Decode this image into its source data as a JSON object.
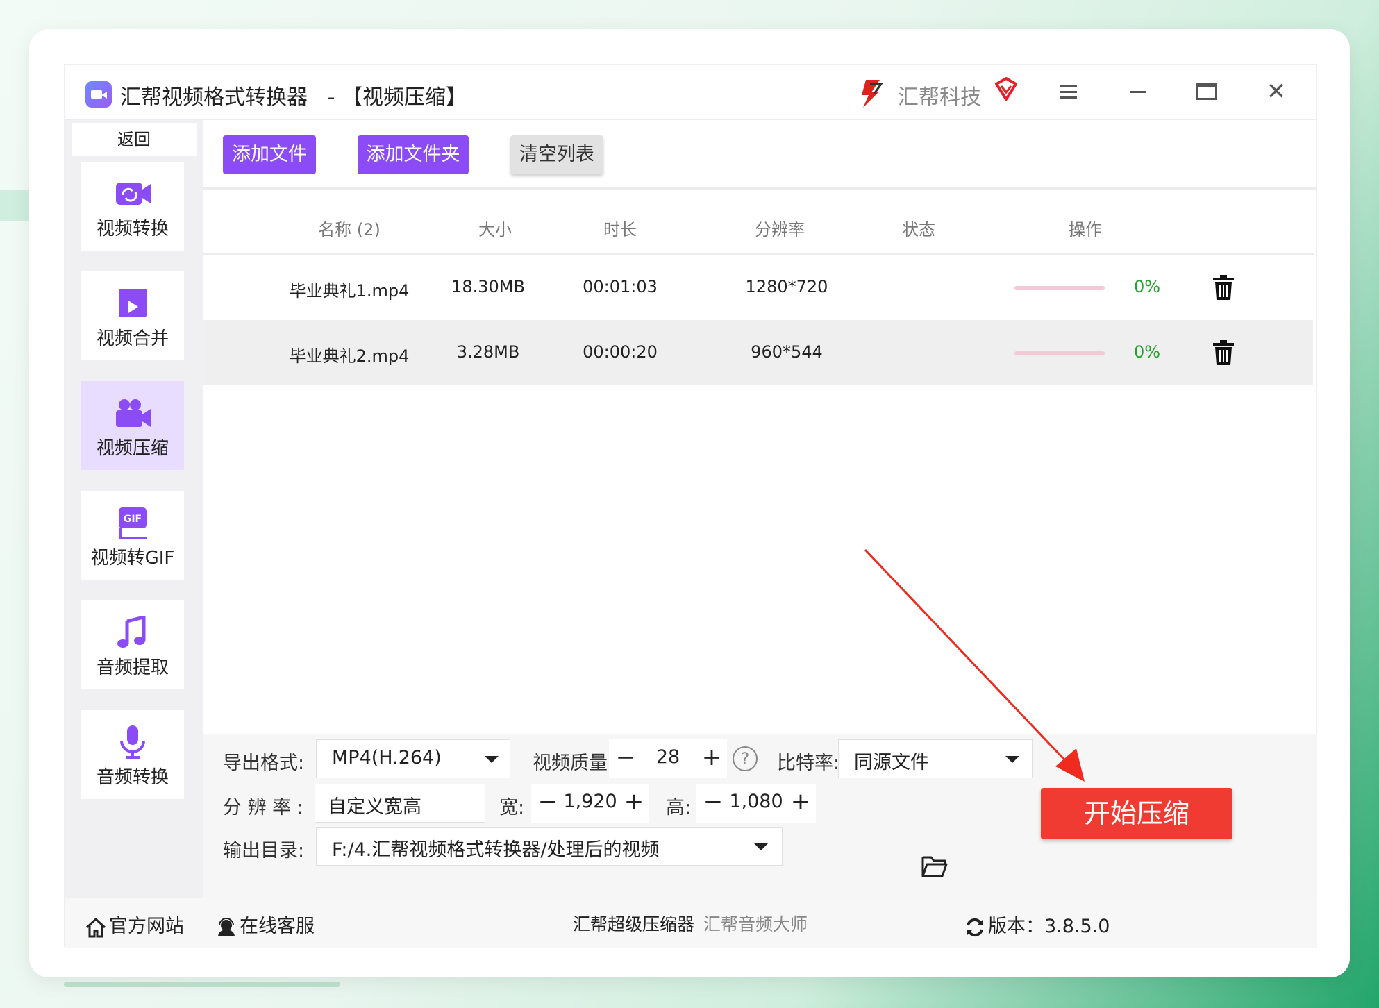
{
  "window": {
    "app_title": "汇帮视频格式转换器",
    "page_title": "【视频压缩】",
    "separator": "-",
    "brand_name": "汇帮科技",
    "close_glyph": "✕"
  },
  "sidebar": {
    "back_label": "返回",
    "items": [
      {
        "label": "视频转换",
        "icon": "video-convert-icon"
      },
      {
        "label": "视频合并",
        "icon": "video-merge-icon"
      },
      {
        "label": "视频压缩",
        "icon": "video-compress-icon",
        "active": true
      },
      {
        "label": "视频转GIF",
        "icon": "gif-icon"
      },
      {
        "label": "音频提取",
        "icon": "music-note-icon"
      },
      {
        "label": "音频转换",
        "icon": "microphone-icon"
      }
    ]
  },
  "toolbar": {
    "add_file": "添加文件",
    "add_folder": "添加文件夹",
    "clear_list": "清空列表"
  },
  "table": {
    "headers": [
      "名称 (2)",
      "大小",
      "时长",
      "分辨率",
      "状态",
      "操作"
    ],
    "rows": [
      {
        "name": "毕业典礼1.mp4",
        "size": "18.30MB",
        "duration": "00:01:03",
        "resolution": "1280*720",
        "progress": 0,
        "status": "0%"
      },
      {
        "name": "毕业典礼2.mp4",
        "size": "3.28MB",
        "duration": "00:00:20",
        "resolution": "960*544",
        "progress": 0,
        "status": "0%"
      }
    ]
  },
  "settings": {
    "format_label": "导出格式:",
    "format_value": "MP4(H.264)",
    "quality_label": "视频质量:",
    "quality_value": "28",
    "bitrate_label": "比特率:",
    "bitrate_value": "同源文件",
    "resolution_label": "分 辨 率 :",
    "resolution_value": "自定义宽高",
    "width_label": "宽:",
    "width_value": "1,920",
    "height_label": "高:",
    "height_value": "1,080",
    "output_label": "输出目录:",
    "output_value": "F:/4.汇帮视频格式转换器/处理后的视频",
    "start_button": "开始压缩",
    "help_glyph": "?"
  },
  "statusbar": {
    "website": "官方网站",
    "support": "在线客服",
    "link1": "汇帮超级压缩器",
    "link2": "汇帮音频大师",
    "version": "版本：3.8.5.0"
  },
  "colors": {
    "accent": "#8b4cf6",
    "start": "#f03b32",
    "progress_text": "#24a12c",
    "annotation_arrow": "#f02a1e"
  }
}
